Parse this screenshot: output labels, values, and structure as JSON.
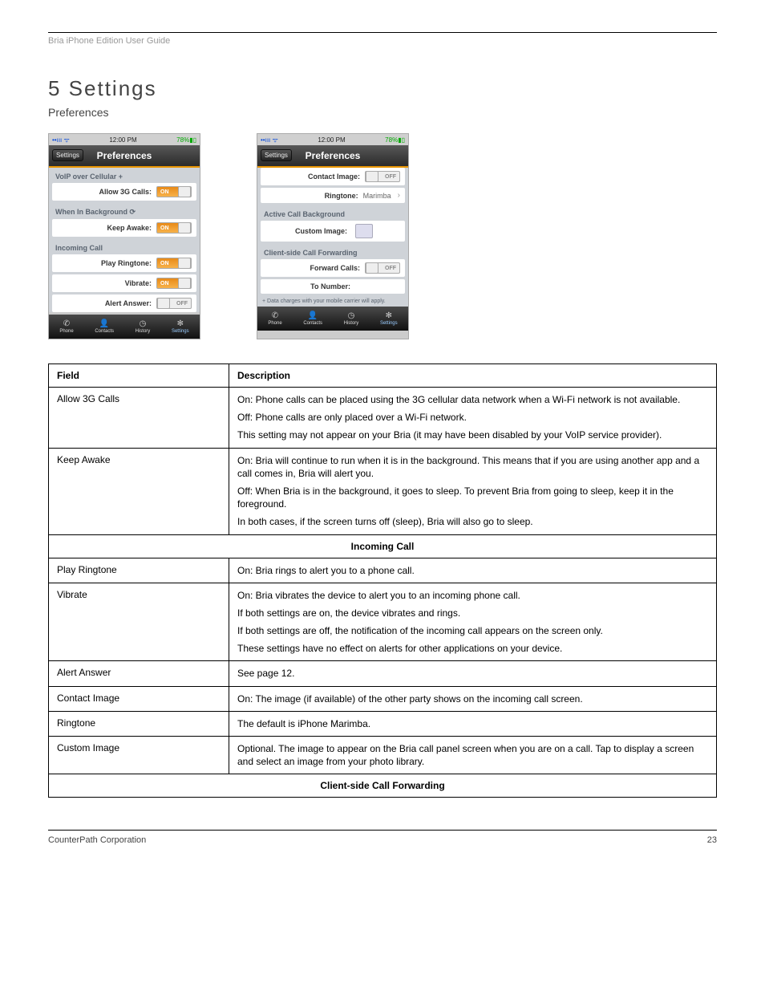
{
  "header": {
    "left": "Bria iPhone Edition User Guide",
    "right": ""
  },
  "title": "5 Settings",
  "subhead": "Preferences",
  "left_screen": {
    "status": {
      "time": "12:00 PM",
      "battery": "78%"
    },
    "nav": {
      "back": "Settings",
      "title": "Preferences"
    },
    "sections": [
      {
        "label": "VoIP over Cellular  +",
        "rows": [
          {
            "name": "allow-3g",
            "label": "Allow 3G Calls:",
            "toggle": "ON"
          }
        ]
      },
      {
        "label": "When In Background  ⟳",
        "rows": [
          {
            "name": "keep-awake",
            "label": "Keep Awake:",
            "toggle": "ON"
          }
        ]
      },
      {
        "label": "Incoming Call",
        "rows": [
          {
            "name": "play-ringtone",
            "label": "Play Ringtone:",
            "toggle": "ON"
          },
          {
            "name": "vibrate",
            "label": "Vibrate:",
            "toggle": "ON"
          },
          {
            "name": "alert-answer",
            "label": "Alert Answer:",
            "toggle": "OFF"
          }
        ]
      }
    ],
    "tabs": [
      "Phone",
      "Contacts",
      "History",
      "Settings"
    ]
  },
  "right_screen": {
    "status": {
      "time": "12:00 PM",
      "battery": "78%"
    },
    "nav": {
      "back": "Settings",
      "title": "Preferences"
    },
    "sections": [
      {
        "label": "",
        "rows": [
          {
            "name": "contact-image",
            "label": "Contact Image:",
            "toggle": "OFF"
          },
          {
            "name": "ringtone",
            "label": "Ringtone:",
            "value": "Marimba",
            "type": "nav"
          }
        ]
      },
      {
        "label": "Active Call Background",
        "rows": [
          {
            "name": "custom-image",
            "label": "Custom Image:",
            "type": "image"
          }
        ]
      },
      {
        "label": "Client-side Call Forwarding",
        "rows": [
          {
            "name": "forward-calls",
            "label": "Forward Calls:",
            "toggle": "OFF"
          },
          {
            "name": "to-number",
            "label": "To Number:",
            "type": "text"
          }
        ]
      }
    ],
    "footnote": "+ Data charges with your mobile carrier will apply.",
    "tabs": [
      "Phone",
      "Contacts",
      "History",
      "Settings"
    ]
  },
  "table": {
    "head": [
      "Field",
      "Description"
    ],
    "rows": [
      {
        "f": "Allow 3G Calls",
        "d": [
          "On: Phone calls can be placed using the 3G cellular data network when a Wi-Fi network is not available.",
          "Off: Phone calls are only placed over a Wi-Fi network.",
          "This setting may not appear on your Bria (it may have been disabled by your VoIP service provider)."
        ]
      },
      {
        "f": "Keep Awake",
        "d": [
          "On: Bria will continue to run when it is in the background. This means that if you are using another app and a call comes in, Bria will alert you.",
          "Off: When Bria is in the background, it goes to sleep. To prevent Bria from going to sleep, keep it in the foreground.",
          "In both cases, if the screen turns off (sleep), Bria will also go to sleep."
        ]
      },
      {
        "section": "Incoming Call"
      },
      {
        "f": "Play Ringtone",
        "d": [
          "On: Bria rings to alert you to a phone call."
        ]
      },
      {
        "f": "Vibrate",
        "d": [
          "On: Bria vibrates the device to alert you to an incoming phone call.",
          "If both settings are on, the device vibrates and rings.",
          "If both settings are off, the notification of the incoming call appears on the screen only.",
          "These settings have no effect on alerts for other applications on your device."
        ]
      },
      {
        "f": "Alert Answer",
        "d": [
          "See page 12."
        ]
      },
      {
        "f": "Contact Image",
        "d": [
          "On: The image (if available) of the other party shows on the incoming call screen."
        ]
      },
      {
        "f": "Ringtone",
        "d": [
          "The default is iPhone Marimba."
        ]
      },
      {
        "f": "Custom Image",
        "d": [
          "Optional. The image to appear on the Bria call panel screen when you are on a call. Tap to display a screen and select an image from your photo library."
        ]
      },
      {
        "section": "Client-side Call Forwarding"
      }
    ]
  },
  "footer": {
    "left": "CounterPath Corporation",
    "right": "23"
  }
}
